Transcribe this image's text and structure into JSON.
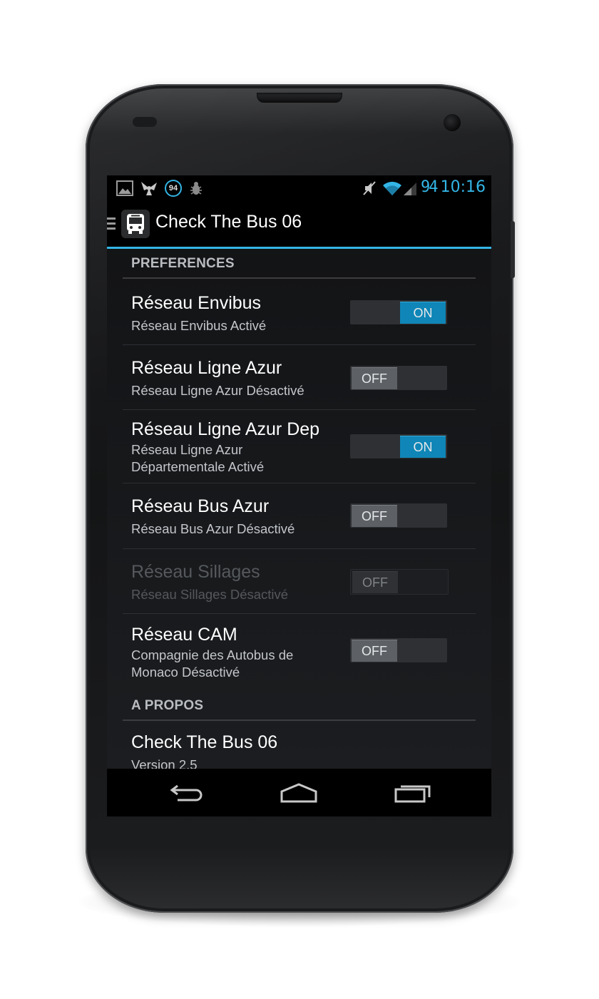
{
  "status_bar": {
    "notification_badge": "94",
    "battery": "94",
    "time": "10:16",
    "left_icons": [
      "gallery-icon",
      "fan-icon",
      "badge-94-icon",
      "bug-icon"
    ],
    "right_icons": [
      "mute-icon",
      "wifi-icon",
      "signal-icon"
    ]
  },
  "action_bar": {
    "title": "Check The Bus 06",
    "icon": "bus-icon"
  },
  "colors": {
    "accent": "#33b5e5",
    "switch_on": "#0f86b7",
    "switch_off": "#5d6064"
  },
  "preferences": {
    "header": "PREFERENCES",
    "items": [
      {
        "title": "Réseau Envibus",
        "summary": "Réseau Envibus Activé",
        "switch": "ON",
        "state": "on"
      },
      {
        "title": "Réseau Ligne Azur",
        "summary": "Réseau Ligne Azur Désactivé",
        "switch": "OFF",
        "state": "off"
      },
      {
        "title": "Réseau Ligne Azur Dep",
        "summary": "Réseau Ligne Azur Départementale Activé",
        "switch": "ON",
        "state": "on"
      },
      {
        "title": "Réseau Bus Azur",
        "summary": "Réseau Bus Azur Désactivé",
        "switch": "OFF",
        "state": "off"
      },
      {
        "title": "Réseau Sillages",
        "summary": "Réseau Sillages Désactivé",
        "switch": "OFF",
        "state": "disabled"
      },
      {
        "title": "Réseau CAM",
        "summary": "Compagnie des Autobus de Monaco Désactivé",
        "switch": "OFF",
        "state": "off"
      }
    ]
  },
  "about": {
    "header": "A PROPOS",
    "title": "Check The Bus 06",
    "version": "Version 2.5"
  },
  "nav_bar": {
    "buttons": [
      "back-icon",
      "home-icon",
      "recent-apps-icon"
    ]
  }
}
